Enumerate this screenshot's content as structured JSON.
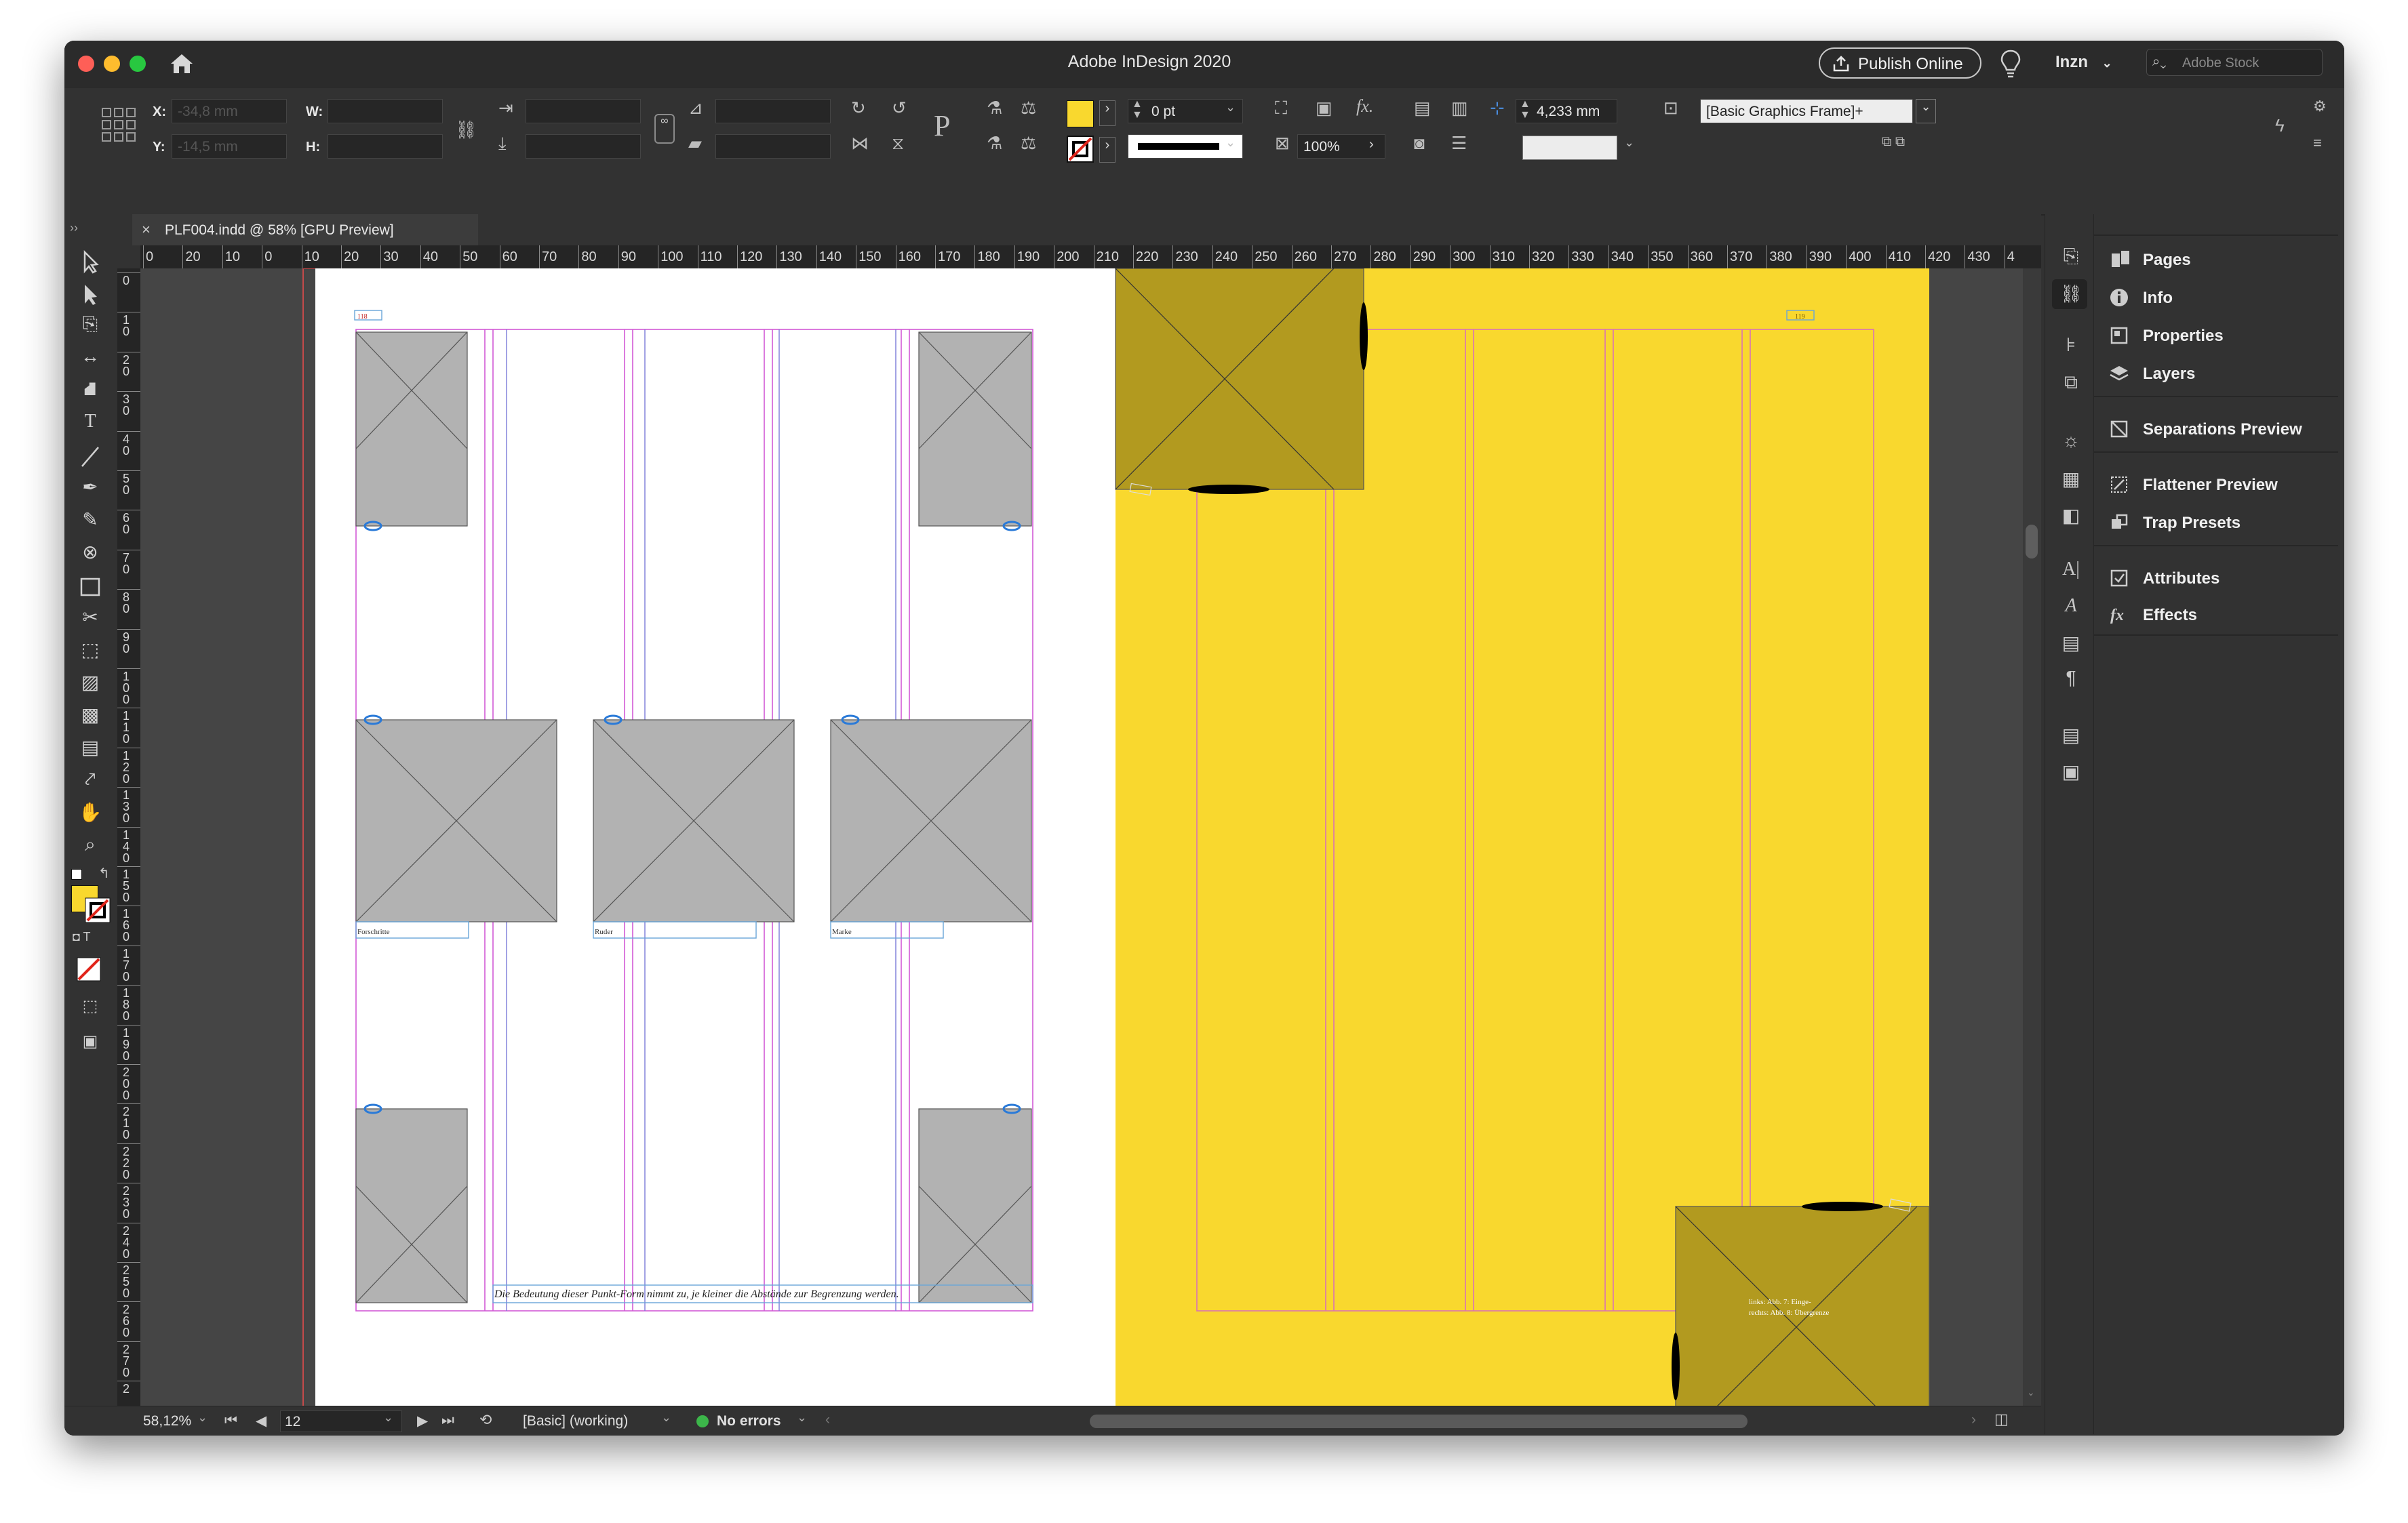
{
  "window": {
    "app_title": "Adobe InDesign 2020",
    "publish_label": "Publish Online",
    "workspace": "Inzn",
    "search_placeholder": "Adobe Stock"
  },
  "control": {
    "x_label": "X:",
    "y_label": "Y:",
    "w_label": "W:",
    "h_label": "H:",
    "x_value": "-34,8 mm",
    "y_value": "-14,5 mm",
    "stroke_weight": "0 pt",
    "opacity": "100%",
    "spacing": "4,233 mm",
    "object_style": "[Basic Graphics Frame]+",
    "fill_color": "#f9d82e"
  },
  "document_tab": {
    "title": "PLF004.indd @ 58% [GPU Preview]"
  },
  "ruler": {
    "h_ticks": [
      "0",
      "20",
      "10",
      "0",
      "10",
      "20",
      "30",
      "40",
      "50",
      "60",
      "70",
      "80",
      "90",
      "100",
      "110",
      "120",
      "130",
      "140",
      "150",
      "160",
      "170",
      "180",
      "190",
      "200",
      "210",
      "220",
      "230",
      "240",
      "250",
      "260",
      "270",
      "280",
      "290",
      "300",
      "310",
      "320",
      "330",
      "340",
      "350",
      "360",
      "370",
      "380",
      "390",
      "400",
      "410",
      "420",
      "430",
      "4"
    ],
    "v_ticks": [
      "0",
      "1 0",
      "2 0",
      "3 0",
      "4 0",
      "5 0",
      "6 0",
      "7 0",
      "8 0",
      "9 0",
      "1 0 0",
      "1 1 0",
      "1 2 0",
      "1 3 0",
      "1 4 0",
      "1 5 0",
      "1 6 0",
      "1 7 0",
      "1 8 0",
      "1 9 0",
      "2 0 0",
      "2 1 0",
      "2 2 0",
      "2 3 0",
      "2 4 0",
      "2 5 0",
      "2 6 0",
      "2 7 0",
      "2"
    ]
  },
  "page": {
    "left_folio": "118",
    "right_folio": "119",
    "captions": [
      "Forschritte",
      "Ruder",
      "Marke"
    ],
    "body_text": "Die Bedeutung dieser Punkt-Form nimmt zu, je kleiner die Abstände zur Begrenzung werden.",
    "right_caption": "links: Abb. 7: Einge-\nrechts: Abb. 8: Übergrenze"
  },
  "status": {
    "zoom": "58,12%",
    "page_number": "12",
    "preflight_profile": "[Basic] (working)",
    "errors": "No errors"
  },
  "panels": [
    {
      "label": "Pages",
      "icon": "pages-icon"
    },
    {
      "label": "Info",
      "icon": "info-icon"
    },
    {
      "label": "Properties",
      "icon": "properties-icon"
    },
    {
      "label": "Layers",
      "icon": "layers-icon"
    },
    {
      "label": "Separations Preview",
      "icon": "separations-icon"
    },
    {
      "label": "Flattener Preview",
      "icon": "flattener-icon"
    },
    {
      "label": "Trap Presets",
      "icon": "trap-presets-icon"
    },
    {
      "label": "Attributes",
      "icon": "attributes-icon"
    },
    {
      "label": "Effects",
      "icon": "effects-icon"
    }
  ],
  "colors": {
    "accent_yellow": "#f9d82e",
    "frame_gray": "#b2b2b2",
    "frame_olive": "#b29a1f",
    "margin_guide": "#d25ad6",
    "status_ok": "#3cb64a"
  }
}
